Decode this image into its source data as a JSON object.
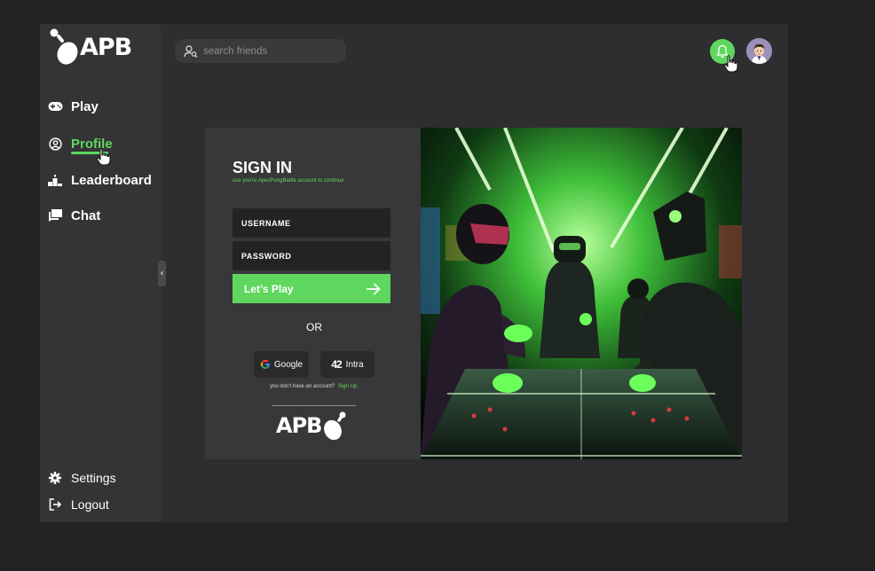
{
  "app": {
    "logo_text": "APB"
  },
  "sidebar": {
    "items": [
      {
        "label": "Play",
        "icon": "gamepad-icon"
      },
      {
        "label": "Profile",
        "icon": "user-circle-icon",
        "active": true
      },
      {
        "label": "Leaderboard",
        "icon": "podium-icon"
      },
      {
        "label": "Chat",
        "icon": "chat-icon"
      }
    ],
    "bottom_items": [
      {
        "label": "Settings",
        "icon": "gear-icon"
      },
      {
        "label": "Logout",
        "icon": "logout-icon"
      }
    ],
    "collapse_icon": "chevron-left-icon"
  },
  "header": {
    "search_placeholder": "search friends",
    "notification_icon": "bell-icon",
    "avatar": "user-avatar"
  },
  "signin": {
    "title": "SIGN IN",
    "subtitle": "use you're ApexPongBattle account to continue",
    "username_placeholder": "USERNAME",
    "password_placeholder": "PASSWORD",
    "play_label": "Let’s Play",
    "or_label": "OR",
    "google_label": "Google",
    "intra_label": "Intra",
    "intra_logo": "42",
    "no_account_text": "you don't have an account?",
    "signup_link": "Sign Up.",
    "bottom_logo_text": "APB"
  },
  "colors": {
    "accent": "#5fd75f",
    "background": "#232324",
    "panel": "#2e2e30",
    "sidebar": "#343436",
    "card": "#38383a"
  }
}
